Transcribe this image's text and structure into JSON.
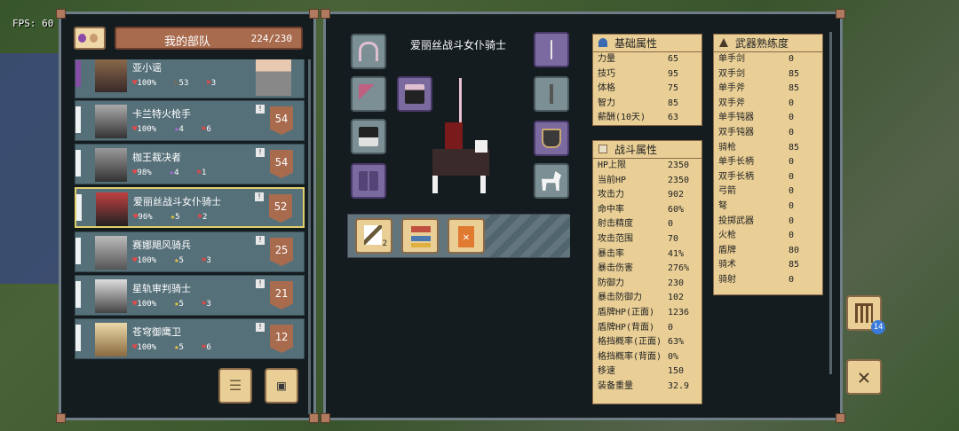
{
  "hud": {
    "fps": "FPS: 60"
  },
  "troops": {
    "title": "我的部队",
    "count": "224/230",
    "rows": [
      {
        "name": "亚小谣",
        "hp": "100%",
        "v2": "53",
        "v3": "3",
        "level": ""
      },
      {
        "name": "卡兰特火枪手",
        "hp": "100%",
        "v2": "4",
        "v3": "6",
        "level": "54"
      },
      {
        "name": "枷王裁决者",
        "hp": "98%",
        "v2": "4",
        "v3": "1",
        "level": "54"
      },
      {
        "name": "爱丽丝战斗女仆骑士",
        "hp": "96%",
        "v2": "5",
        "v3": "2",
        "level": "52"
      },
      {
        "name": "赛娜飓风骑兵",
        "hp": "100%",
        "v2": "5",
        "v3": "3",
        "level": "25"
      },
      {
        "name": "星轨审判骑士",
        "hp": "100%",
        "v2": "5",
        "v3": "3",
        "level": "21"
      },
      {
        "name": "苍穹御鹰卫",
        "hp": "100%",
        "v2": "5",
        "v3": "6",
        "level": "12"
      }
    ]
  },
  "unit": {
    "name": "爱丽丝战斗女仆骑士",
    "badge": "2"
  },
  "basic": {
    "title": "基础属性",
    "rows": [
      {
        "k": "力量",
        "v": "65"
      },
      {
        "k": "技巧",
        "v": "95"
      },
      {
        "k": "体格",
        "v": "75"
      },
      {
        "k": "智力",
        "v": "85"
      },
      {
        "k": "薪酬(10天)",
        "v": "63"
      }
    ]
  },
  "combat": {
    "title": "战斗属性",
    "rows": [
      {
        "k": "HP上限",
        "v": "2350"
      },
      {
        "k": "当前HP",
        "v": "2350"
      },
      {
        "k": "攻击力",
        "v": "902"
      },
      {
        "k": "命中率",
        "v": "60%"
      },
      {
        "k": "射击精度",
        "v": "0"
      },
      {
        "k": "攻击范围",
        "v": "70"
      },
      {
        "k": "暴击率",
        "v": "41%"
      },
      {
        "k": "暴击伤害",
        "v": "276%"
      },
      {
        "k": "防御力",
        "v": "230"
      },
      {
        "k": "暴击防御力",
        "v": "102"
      },
      {
        "k": "盾牌HP(正面)",
        "v": "1236"
      },
      {
        "k": "盾牌HP(背面)",
        "v": "0"
      },
      {
        "k": "格挡概率(正面)",
        "v": "63%"
      },
      {
        "k": "格挡概率(背面)",
        "v": "0%"
      },
      {
        "k": "移速",
        "v": "150"
      },
      {
        "k": "装备重量",
        "v": "32.9"
      }
    ]
  },
  "weapons": {
    "title": "武器熟练度",
    "rows": [
      {
        "k": "单手剑",
        "v": "0"
      },
      {
        "k": "双手剑",
        "v": "85"
      },
      {
        "k": "单手斧",
        "v": "85"
      },
      {
        "k": "双手斧",
        "v": "0"
      },
      {
        "k": "单手钝器",
        "v": "0"
      },
      {
        "k": "双手钝器",
        "v": "0"
      },
      {
        "k": "骑枪",
        "v": "85"
      },
      {
        "k": "单手长柄",
        "v": "0"
      },
      {
        "k": "双手长柄",
        "v": "0"
      },
      {
        "k": "弓箭",
        "v": "0"
      },
      {
        "k": "弩",
        "v": "0"
      },
      {
        "k": "投掷武器",
        "v": "0"
      },
      {
        "k": "火枪",
        "v": "0"
      },
      {
        "k": "盾牌",
        "v": "80"
      },
      {
        "k": "骑术",
        "v": "85"
      },
      {
        "k": "骑射",
        "v": "0"
      }
    ]
  },
  "side": {
    "badge": "14"
  }
}
